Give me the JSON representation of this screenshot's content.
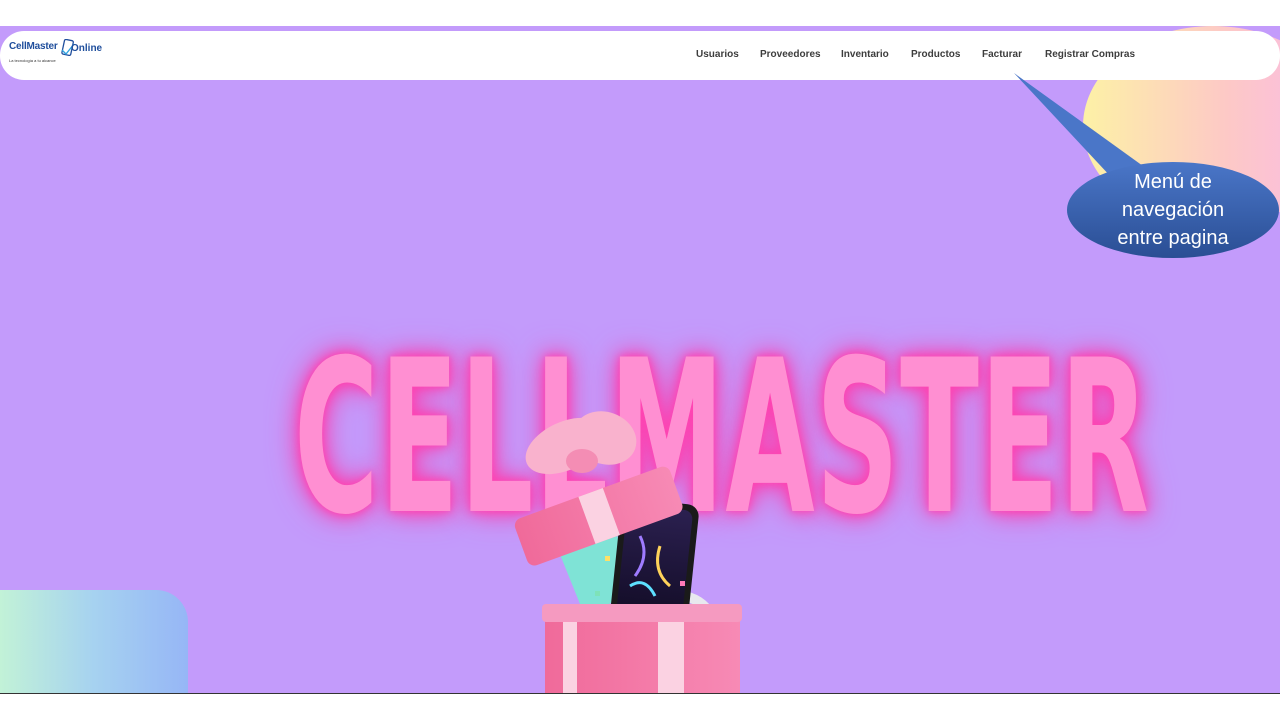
{
  "logo": {
    "brand": "CellMaster",
    "suffix": "Online",
    "tagline": "La tecnología a tu alcance"
  },
  "nav": {
    "items": [
      "Usuarios",
      "Proveedores",
      "Inventario",
      "Productos",
      "Facturar",
      "Registrar Compras"
    ]
  },
  "callout": {
    "line1": "Menú de",
    "line2": "navegación",
    "line3": "entre pagina"
  },
  "hero": {
    "title": "CELLMASTER"
  },
  "colors": {
    "background": "#c39bfb",
    "title_pink": "#ff8fd2",
    "callout_blue": "#2f5597",
    "logo_blue": "#1f4e9c"
  }
}
